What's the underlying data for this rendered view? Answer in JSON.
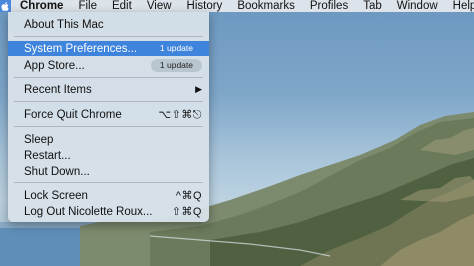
{
  "menubar": {
    "app_name": "Chrome",
    "items": [
      "File",
      "Edit",
      "View",
      "History",
      "Bookmarks",
      "Profiles",
      "Tab",
      "Window",
      "Help"
    ]
  },
  "apple_menu": {
    "about": "About This Mac",
    "system_preferences": "System Preferences...",
    "system_preferences_badge": "1 update",
    "app_store": "App Store...",
    "app_store_badge": "1 update",
    "recent_items": "Recent Items",
    "force_quit": "Force Quit Chrome",
    "force_quit_shortcut": "⌥⇧⌘⎋",
    "sleep": "Sleep",
    "restart": "Restart...",
    "shut_down": "Shut Down...",
    "lock_screen": "Lock Screen",
    "lock_screen_shortcut": "^⌘Q",
    "log_out": "Log Out Nicolette Roux...",
    "log_out_shortcut": "⇧⌘Q"
  },
  "colors": {
    "highlight": "#3f84dc",
    "menubar": "#e2e6eb"
  },
  "icons": {
    "apple": "apple-logo-icon",
    "submenu": "chevron-right-icon"
  }
}
